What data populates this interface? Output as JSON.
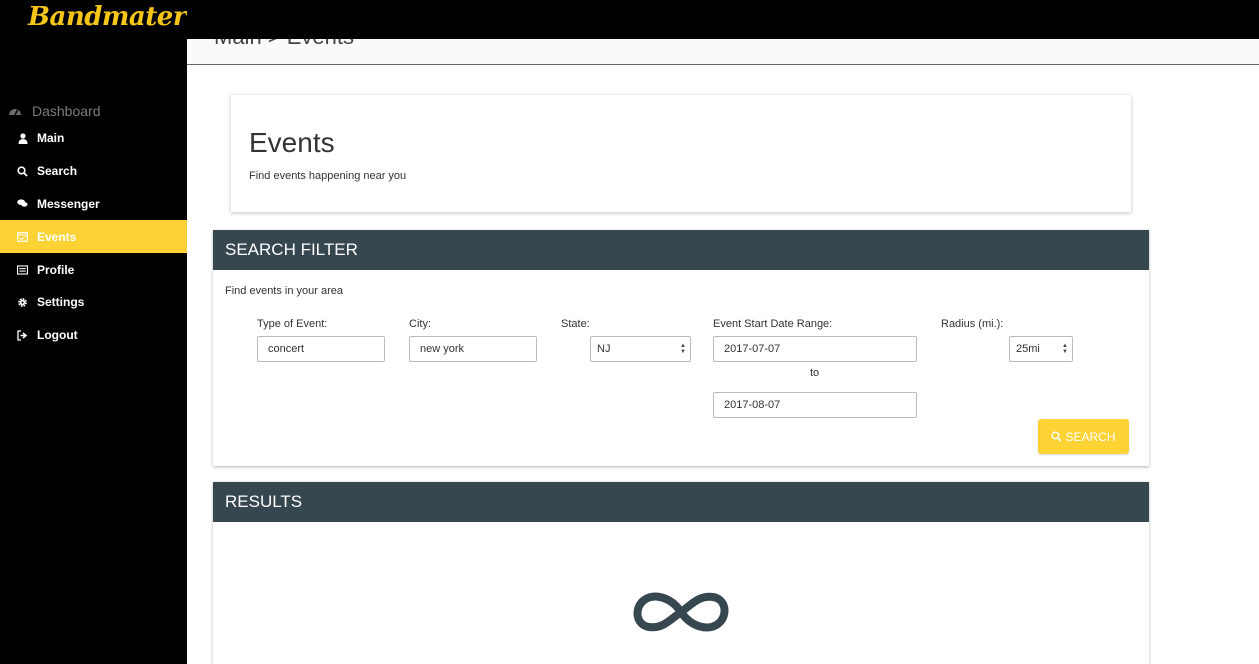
{
  "app": {
    "logo": "Bandmater"
  },
  "sidebar": {
    "heading": "Dashboard",
    "items": [
      {
        "label": "Main",
        "icon": "user-icon"
      },
      {
        "label": "Search",
        "icon": "search-icon"
      },
      {
        "label": "Messenger",
        "icon": "chat-icon"
      },
      {
        "label": "Events",
        "icon": "calendar-icon",
        "active": true
      },
      {
        "label": "Profile",
        "icon": "id-card-icon"
      },
      {
        "label": "Settings",
        "icon": "gear-icon"
      },
      {
        "label": "Logout",
        "icon": "logout-icon"
      }
    ]
  },
  "breadcrumb": {
    "text": "Main > Events"
  },
  "events_card": {
    "title": "Events",
    "subtitle": "Find events happening near you"
  },
  "filter": {
    "title": "SEARCH FILTER",
    "subtitle": "Find events in your area",
    "type_label": "Type of Event:",
    "type_value": "concert",
    "city_label": "City:",
    "city_value": "new york",
    "state_label": "State:",
    "state_value": "NJ",
    "date_label": "Event Start Date Range:",
    "date_start": "2017-07-07",
    "to_label": "to",
    "date_end": "2017-08-07",
    "radius_label": "Radius (mi.):",
    "radius_value": "25mi",
    "search_label": "SEARCH"
  },
  "results": {
    "title": "RESULTS"
  },
  "colors": {
    "accent": "#fdd235",
    "panel_header": "#37474f",
    "sidebar_bg": "#000000",
    "loader": "#37474f"
  }
}
